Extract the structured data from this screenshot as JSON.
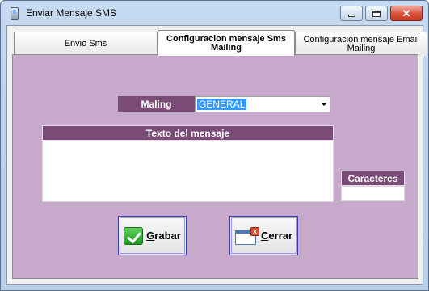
{
  "window": {
    "title": "Enviar Mensaje SMS",
    "controls": {
      "minimize": "minimize-icon",
      "maximize": "maximize-icon",
      "close": "close-icon"
    }
  },
  "tabs": [
    {
      "label": "Envio Sms",
      "active": false
    },
    {
      "label": "Configuracion mensaje Sms Mailing",
      "active": true
    },
    {
      "label": "Configuracion mensaje Email Mailing",
      "active": false
    }
  ],
  "form": {
    "maling_label": "Maling",
    "maling_value": "GENERAL",
    "message_header": "Texto del mensaje",
    "message_value": "",
    "chars_header": "Caracteres",
    "chars_value": ""
  },
  "buttons": {
    "grabar_mnemonic": "G",
    "grabar_rest": "rabar",
    "cerrar_mnemonic": "C",
    "cerrar_rest": "errar"
  },
  "colors": {
    "panel_bg": "#c7aacb",
    "header_bg": "#7b4b78",
    "selection": "#3399ff"
  }
}
